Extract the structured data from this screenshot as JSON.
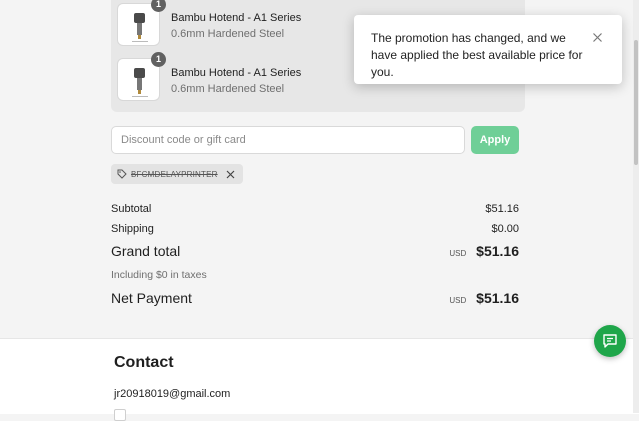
{
  "order_items": [
    {
      "name": "Bambu Hotend - A1 Series",
      "variant": "0.6mm Hardened Steel",
      "quantity": "1"
    },
    {
      "name": "Bambu Hotend - A1 Series",
      "variant": "0.6mm Hardened Steel",
      "quantity": "1"
    }
  ],
  "discount": {
    "placeholder": "Discount code or gift card",
    "value": "",
    "apply_label": "Apply",
    "applied_code": "BFCMDELAYPRINTER"
  },
  "totals": {
    "subtotal_label": "Subtotal",
    "subtotal_value": "$51.16",
    "shipping_label": "Shipping",
    "shipping_value": "$0.00",
    "grand_total_label": "Grand total",
    "grand_total_currency": "USD",
    "grand_total_value": "$51.16",
    "taxes_note": "Including $0 in taxes",
    "net_payment_label": "Net Payment",
    "net_payment_currency": "USD",
    "net_payment_value": "$51.16"
  },
  "contact": {
    "title": "Contact",
    "email": "jr20918019@gmail.com"
  },
  "toast": {
    "message": "The promotion has changed, and we have applied the best available price for you."
  },
  "icons": {
    "tag": "tag-icon",
    "remove": "close-icon",
    "toast_close": "close-icon",
    "chat": "chat-icon"
  },
  "colors": {
    "accent_green": "#1fa64a",
    "apply_button": "#6fcf97",
    "badge": "#616161"
  }
}
